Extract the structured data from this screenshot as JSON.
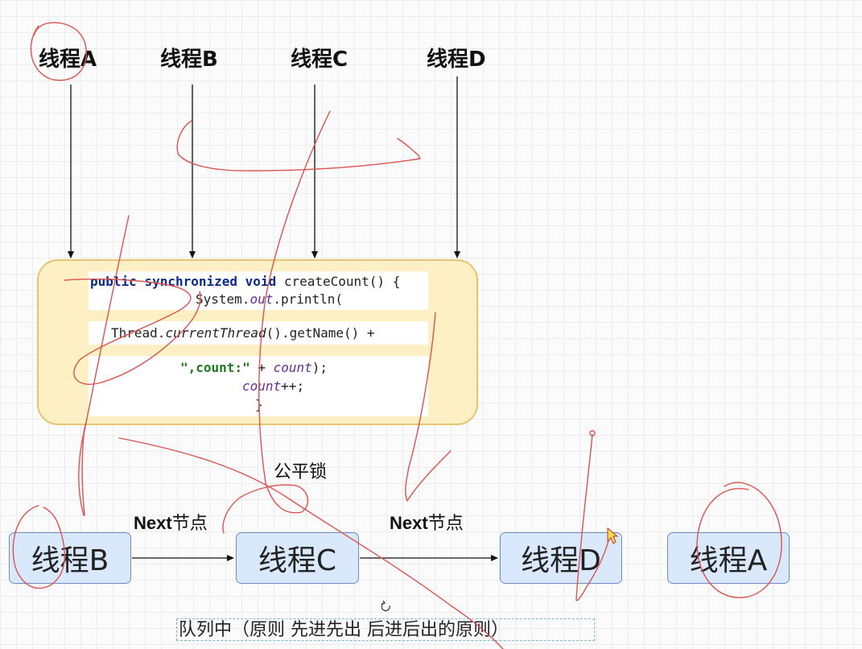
{
  "threads_top": [
    {
      "name": "线程A"
    },
    {
      "name": "线程B"
    },
    {
      "name": "线程C"
    },
    {
      "name": "线程D"
    }
  ],
  "code": {
    "kw_public": "public",
    "kw_synchronized": "synchronized",
    "kw_void": "void",
    "method_decl": " createCount() {",
    "sys_prefix": "System.",
    "sys_out": "out",
    "sys_suffix": ".println(",
    "thread_prefix": "Thread.",
    "thread_current": "currentThread",
    "thread_suffix": "().getName() +",
    "str_count": "\",count:\"",
    "concat_plus": " + ",
    "count_field": "count",
    "close_paren": ");",
    "increment_suffix": "++;",
    "close_brace": "}"
  },
  "fair_lock_label": "公平锁",
  "next_label_bold": "Next",
  "next_label_cn": "节点",
  "queue_nodes": [
    {
      "name": "线程B"
    },
    {
      "name": "线程C"
    },
    {
      "name": "线程D"
    },
    {
      "name": "线程A"
    }
  ],
  "queue_caption": "队列中（原则 先进先出  后进后出的原则）",
  "colors": {
    "node_fill": "#dae8fc",
    "node_border": "#6c8ebf",
    "code_box_fill": "#fdf0c4",
    "code_box_border": "#e4c46c",
    "annotation_ink": "#d9534f"
  }
}
